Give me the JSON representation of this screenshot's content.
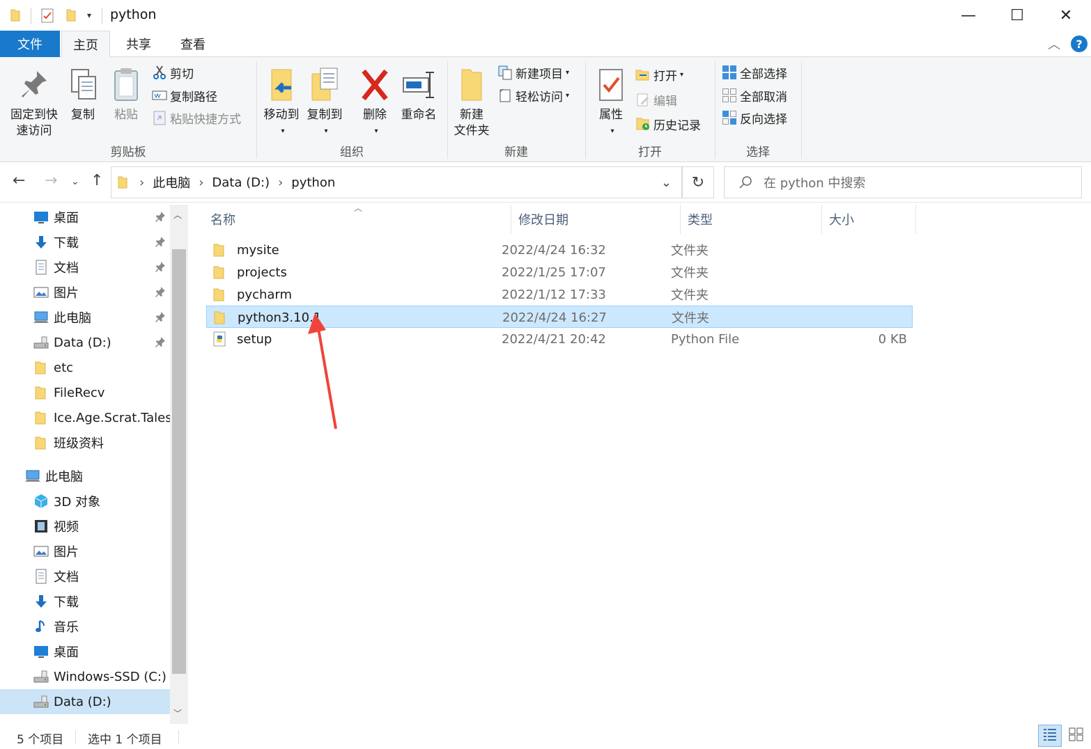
{
  "window": {
    "title": "python",
    "controls": {
      "minimize": "—",
      "maximize": "☐",
      "close": "✕"
    }
  },
  "tabs": {
    "file": "文件",
    "home": "主页",
    "share": "共享",
    "view": "查看"
  },
  "ribbon": {
    "clipboard": {
      "label": "剪贴板",
      "pin_line1": "固定到快",
      "pin_line2": "速访问",
      "copy": "复制",
      "paste": "粘贴",
      "cut": "剪切",
      "copy_path": "复制路径",
      "paste_shortcut": "粘贴快捷方式"
    },
    "organize": {
      "label": "组织",
      "move_to": "移动到",
      "copy_to": "复制到",
      "delete": "删除",
      "rename": "重命名"
    },
    "new": {
      "label": "新建",
      "new_folder_line1": "新建",
      "new_folder_line2": "文件夹",
      "new_item": "新建项目",
      "easy_access": "轻松访问"
    },
    "open": {
      "label": "打开",
      "properties": "属性",
      "open": "打开",
      "edit": "编辑",
      "history": "历史记录"
    },
    "select": {
      "label": "选择",
      "select_all": "全部选择",
      "select_none": "全部取消",
      "invert": "反向选择"
    }
  },
  "address": {
    "crumbs": [
      "此电脑",
      "Data (D:)",
      "python"
    ],
    "search_placeholder": "在 python 中搜索"
  },
  "nav": {
    "quick": [
      {
        "label": "桌面",
        "icon": "desktop-icon"
      },
      {
        "label": "下载",
        "icon": "download-icon"
      },
      {
        "label": "文档",
        "icon": "document-icon"
      },
      {
        "label": "图片",
        "icon": "pictures-icon"
      },
      {
        "label": "此电脑",
        "icon": "computer-icon"
      },
      {
        "label": "Data (D:)",
        "icon": "drive-icon"
      },
      {
        "label": "etc",
        "icon": "folder-icon"
      },
      {
        "label": "FileRecv",
        "icon": "folder-icon"
      },
      {
        "label": "Ice.Age.Scrat.Tales.S",
        "icon": "folder-icon"
      },
      {
        "label": "班级资料",
        "icon": "folder-icon"
      }
    ],
    "this_pc": "此电脑",
    "pc": [
      {
        "label": "3D 对象",
        "icon": "3d-objects-icon"
      },
      {
        "label": "视频",
        "icon": "video-icon"
      },
      {
        "label": "图片",
        "icon": "pictures-icon"
      },
      {
        "label": "文档",
        "icon": "document-icon"
      },
      {
        "label": "下载",
        "icon": "download-icon"
      },
      {
        "label": "音乐",
        "icon": "music-icon"
      },
      {
        "label": "桌面",
        "icon": "desktop-icon"
      },
      {
        "label": "Windows-SSD (C:)",
        "icon": "drive-icon"
      },
      {
        "label": "Data (D:)",
        "icon": "drive-icon"
      }
    ]
  },
  "columns": {
    "name": "名称",
    "modified": "修改日期",
    "type": "类型",
    "size": "大小"
  },
  "files": [
    {
      "name": "mysite",
      "modified": "2022/4/24 16:32",
      "type": "文件夹",
      "size": ""
    },
    {
      "name": "projects",
      "modified": "2022/1/25 17:07",
      "type": "文件夹",
      "size": ""
    },
    {
      "name": "pycharm",
      "modified": "2022/1/12 17:33",
      "type": "文件夹",
      "size": ""
    },
    {
      "name": "python3.10.1",
      "modified": "2022/4/24 16:27",
      "type": "文件夹",
      "size": ""
    },
    {
      "name": "setup",
      "modified": "2022/4/21 20:42",
      "type": "Python File",
      "size": "0 KB"
    }
  ],
  "status": {
    "count": "5 个项目",
    "selected": "选中 1 个项目"
  },
  "colors": {
    "accent": "#1979ca",
    "selection": "#cce8ff",
    "annotation_arrow": "#f0443a"
  }
}
